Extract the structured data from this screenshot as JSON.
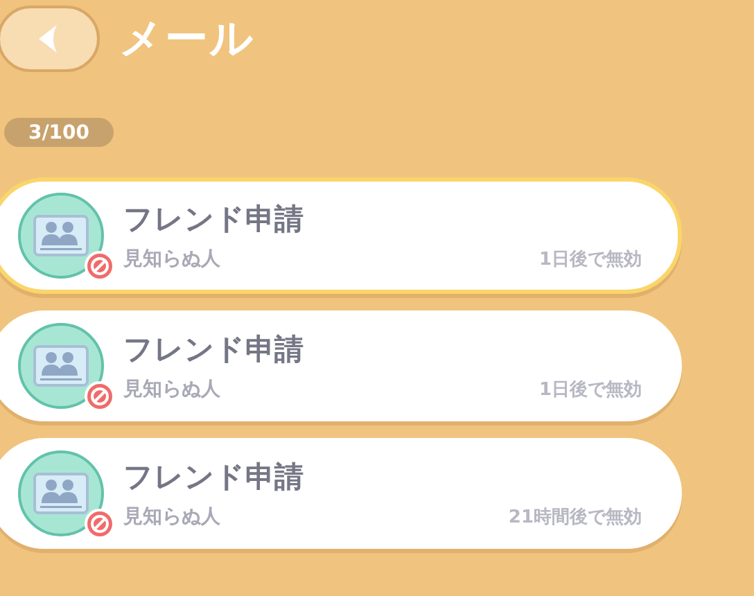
{
  "header": {
    "title": "メール"
  },
  "counter": "3/100",
  "mails": [
    {
      "title": "フレンド申請",
      "sender": "見知らぬ人",
      "expiry": "1日後で無効",
      "selected": true
    },
    {
      "title": "フレンド申請",
      "sender": "見知らぬ人",
      "expiry": "1日後で無効",
      "selected": false
    },
    {
      "title": "フレンド申請",
      "sender": "見知らぬ人",
      "expiry": "21時間後で無効",
      "selected": false
    }
  ]
}
